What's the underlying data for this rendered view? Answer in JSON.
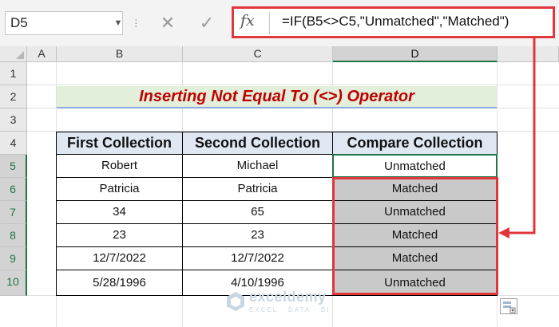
{
  "formula_bar": {
    "name_box": "D5",
    "fx_label": "fx",
    "formula": "=IF(B5<>C5,\"Unmatched\",\"Matched\")",
    "cancel_glyph": "✕",
    "enter_glyph": "✓"
  },
  "grid": {
    "columns": [
      "A",
      "B",
      "C",
      "D"
    ],
    "selected_column": "D",
    "rows": [
      "1",
      "2",
      "3",
      "4",
      "5",
      "6",
      "7",
      "8",
      "9",
      "10"
    ],
    "active_cell": "D5"
  },
  "sheet": {
    "title": "Inserting Not Equal To (<>) Operator",
    "headers": [
      "First Collection",
      "Second Collection",
      "Compare Collection"
    ],
    "rows": [
      [
        "Robert",
        "Michael",
        "Unmatched"
      ],
      [
        "Patricia",
        "Patricia",
        "Matched"
      ],
      [
        "34",
        "65",
        "Unmatched"
      ],
      [
        "23",
        "23",
        "Matched"
      ],
      [
        "12/7/2022",
        "12/7/2022",
        "Matched"
      ],
      [
        "5/28/1996",
        "4/10/1996",
        "Unmatched"
      ]
    ]
  },
  "watermark": {
    "name": "exceldemy",
    "tagline": "EXCEL · DATA · BI"
  },
  "colors": {
    "title_text": "#c00000",
    "title_fill": "#e2efda",
    "header_fill": "#dfe7f3",
    "compare_fill": "#c9c9c9",
    "annotation": "#e0373b",
    "excel_green": "#217346"
  },
  "icons": [
    "chevron-down-icon",
    "cancel-icon",
    "enter-icon",
    "fx-icon",
    "quick-analysis-icon",
    "logo-icon"
  ]
}
